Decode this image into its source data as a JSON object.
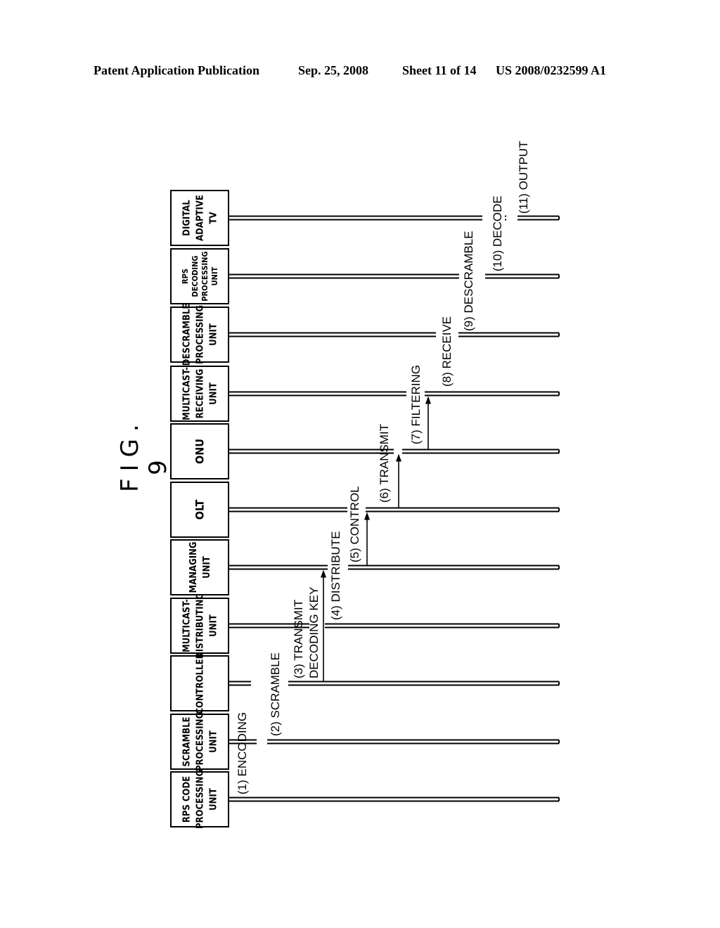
{
  "header": {
    "publication": "Patent Application Publication",
    "date": "Sep. 25, 2008",
    "sheet": "Sheet 11 of 14",
    "patent_number": "US 2008/0232599 A1"
  },
  "figure": {
    "title": "FIG. 9",
    "participants": [
      {
        "id": "rps-code",
        "lines": [
          "RPS CODE",
          "PROCESSING",
          "UNIT"
        ]
      },
      {
        "id": "scramble",
        "lines": [
          "SCRAMBLE",
          "PROCESSING",
          "UNIT"
        ]
      },
      {
        "id": "controller",
        "lines": [
          "CONTROLLER"
        ]
      },
      {
        "id": "multicast-distributing",
        "lines": [
          "MULTICAST-",
          "DISTRIBUTING",
          "UNIT"
        ]
      },
      {
        "id": "managing",
        "lines": [
          "MANAGING",
          "UNIT"
        ]
      },
      {
        "id": "olt",
        "lines": [
          "OLT"
        ]
      },
      {
        "id": "onu",
        "lines": [
          "ONU"
        ]
      },
      {
        "id": "multicast-receiving",
        "lines": [
          "MULTICAST-",
          "RECEIVING",
          "UNIT"
        ]
      },
      {
        "id": "descramble",
        "lines": [
          "DESCRAMBLE",
          "PROCESSING",
          "UNIT"
        ]
      },
      {
        "id": "rps-decoding",
        "lines": [
          "RPS",
          "DECODING",
          "PROCESSING",
          "UNIT"
        ]
      },
      {
        "id": "digital-tv",
        "lines": [
          "DIGITAL",
          "ADAPTIVE",
          "TV"
        ]
      }
    ],
    "steps": [
      {
        "id": "1",
        "lines": [
          "(1) ENCODING"
        ],
        "on": "rps-code"
      },
      {
        "id": "2",
        "lines": [
          "(2) SCRAMBLE"
        ],
        "on": "scramble"
      },
      {
        "id": "3",
        "lines": [
          "(3) TRANSMIT",
          "DECODING KEY"
        ],
        "from": "controller",
        "to": "managing"
      },
      {
        "id": "4",
        "lines": [
          "(4) DISTRIBUTE"
        ],
        "on": "multicast-distributing"
      },
      {
        "id": "5",
        "lines": [
          "(5) CONTROL"
        ],
        "from": "managing",
        "to": "olt"
      },
      {
        "id": "6",
        "lines": [
          "(6) TRANSMIT"
        ],
        "from": "olt",
        "to": "onu"
      },
      {
        "id": "7",
        "lines": [
          "(7) FILTERING"
        ],
        "from": "onu",
        "to": "multicast-receiving"
      },
      {
        "id": "8",
        "lines": [
          "(8) RECEIVE"
        ],
        "on": "multicast-receiving"
      },
      {
        "id": "9",
        "lines": [
          "(9) DESCRAMBLE"
        ],
        "on": "descramble"
      },
      {
        "id": "10",
        "lines": [
          "(10) DECODE"
        ],
        "on": "rps-decoding"
      },
      {
        "id": "11",
        "lines": [
          "(11) OUTPUT"
        ],
        "on": "digital-tv"
      }
    ]
  }
}
